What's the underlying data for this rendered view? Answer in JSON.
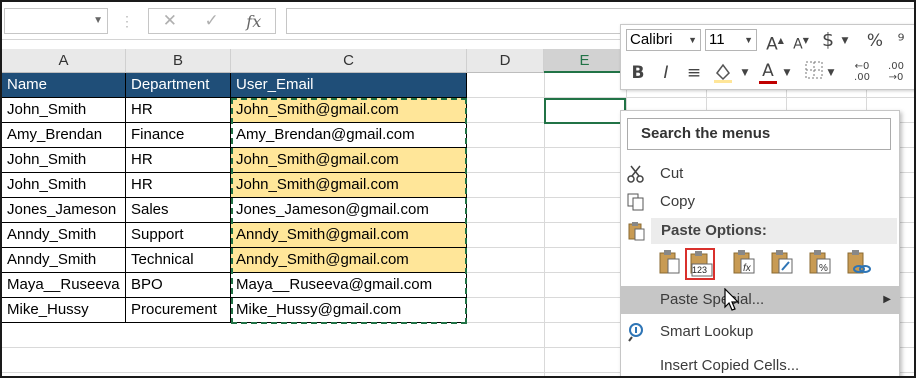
{
  "formula_bar": {
    "name_box_value": "",
    "cancel_glyph": "✕",
    "enter_glyph": "✓",
    "fx_label": "fx",
    "formula_value": ""
  },
  "columns": [
    "A",
    "B",
    "C",
    "D",
    "E"
  ],
  "table": {
    "headers": [
      "Name",
      "Department",
      "User_Email"
    ],
    "rows": [
      {
        "name": "John_Smith",
        "dept": "HR",
        "email": "John_Smith@gmail.com",
        "dup": true
      },
      {
        "name": "Amy_Brendan",
        "dept": "Finance",
        "email": "Amy_Brendan@gmail.com",
        "dup": false
      },
      {
        "name": "John_Smith",
        "dept": "HR",
        "email": "John_Smith@gmail.com",
        "dup": true
      },
      {
        "name": "John_Smith",
        "dept": "HR",
        "email": "John_Smith@gmail.com",
        "dup": true
      },
      {
        "name": "Jones_Jameson",
        "dept": "Sales",
        "email": "Jones_Jameson@gmail.com",
        "dup": false
      },
      {
        "name": "Anndy_Smith",
        "dept": "Support",
        "email": "Anndy_Smith@gmail.com",
        "dup": true
      },
      {
        "name": "Anndy_Smith",
        "dept": "Technical",
        "email": "Anndy_Smith@gmail.com",
        "dup": true
      },
      {
        "name": "Maya__Ruseeva",
        "dept": "BPO",
        "email": "Maya__Ruseeva@gmail.com",
        "dup": false
      },
      {
        "name": "Mike_Hussy",
        "dept": "Procurement",
        "email": "Mike_Hussy@gmail.com",
        "dup": false
      }
    ]
  },
  "colors": {
    "header_fill": "#1f4e78",
    "duplicate_fill": "#ffe699",
    "selection": "#217346",
    "paste_highlight": "#d9302c"
  },
  "mini_toolbar": {
    "font_name": "Calibri",
    "font_size": "11",
    "grow_font": "A",
    "shrink_font": "A",
    "currency": "$",
    "percent": "%",
    "bold": "B",
    "italic": "I",
    "font_color": "A"
  },
  "context_menu": {
    "search_placeholder": "Search the menus",
    "cut": "Cut",
    "copy": "Copy",
    "paste_options_label": "Paste Options:",
    "paste_values_badge": "123",
    "paste_special": "Paste Special...",
    "smart_lookup": "Smart Lookup",
    "insert_copied": "Insert Copied Cells..."
  }
}
